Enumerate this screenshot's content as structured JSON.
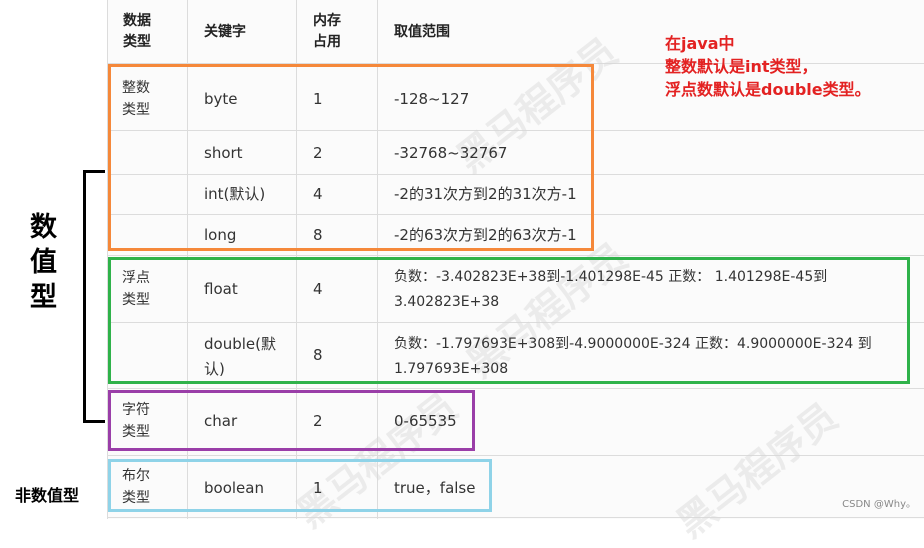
{
  "headers": [
    "数据\n类型",
    "关键字",
    "内存\n占用",
    "取值范围"
  ],
  "rows": [
    {
      "type": "整数\n类型",
      "keyword": "byte",
      "size": "1",
      "range": "-128~127"
    },
    {
      "type": "",
      "keyword": "short",
      "size": "2",
      "range": "-32768~32767"
    },
    {
      "type": "",
      "keyword": "int(默认)",
      "size": "4",
      "range": "-2的31次方到2的31次方-1"
    },
    {
      "type": "",
      "keyword": "long",
      "size": "8",
      "range": "-2的63次方到2的63次方-1"
    },
    {
      "type": "浮点\n类型",
      "keyword": "float",
      "size": "4",
      "range": "负数：-3.402823E+38到-1.401298E-45 正数： 1.401298E-45到\n3.402823E+38"
    },
    {
      "type": "",
      "keyword": "double(默\n认)",
      "size": "8",
      "range": "负数：-1.797693E+308到-4.9000000E-324 正数：4.9000000E-324 到\n1.797693E+308"
    },
    {
      "type": "字符\n类型",
      "keyword": "char",
      "size": "2",
      "range": "0-65535"
    },
    {
      "type": "布尔\n类型",
      "keyword": "boolean",
      "size": "1",
      "range": "true，false"
    }
  ],
  "annotation": {
    "lines": [
      "在java中",
      "整数默认是int类型，",
      "浮点数默认是double类型。"
    ]
  },
  "side_labels": {
    "numeric": "数\n值\n型",
    "non_numeric": "非数值型"
  },
  "watermark": "黑马程序员",
  "credit": "CSDN @Why。",
  "colors": {
    "integer_box": "#f5883a",
    "float_box": "#2fb24a",
    "char_box": "#9a3ea8",
    "boolean_box": "#8fd3e8",
    "annotation": "#e32222",
    "bracket": "#000000"
  }
}
